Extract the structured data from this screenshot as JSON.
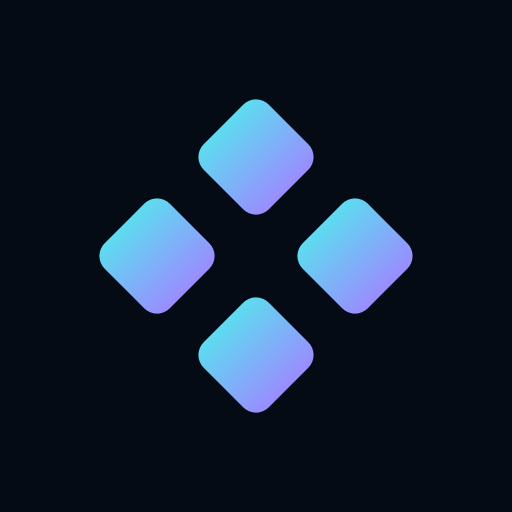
{
  "app_icon": {
    "icon_name": "four-diamond-grid-logo",
    "colors": {
      "background": "#050b14",
      "gradient_start": "#5ddcf0",
      "gradient_end": "#9a8cff"
    },
    "tiles": [
      {
        "name": "diamond-tile-top"
      },
      {
        "name": "diamond-tile-left"
      },
      {
        "name": "diamond-tile-right"
      },
      {
        "name": "diamond-tile-bottom"
      }
    ]
  }
}
